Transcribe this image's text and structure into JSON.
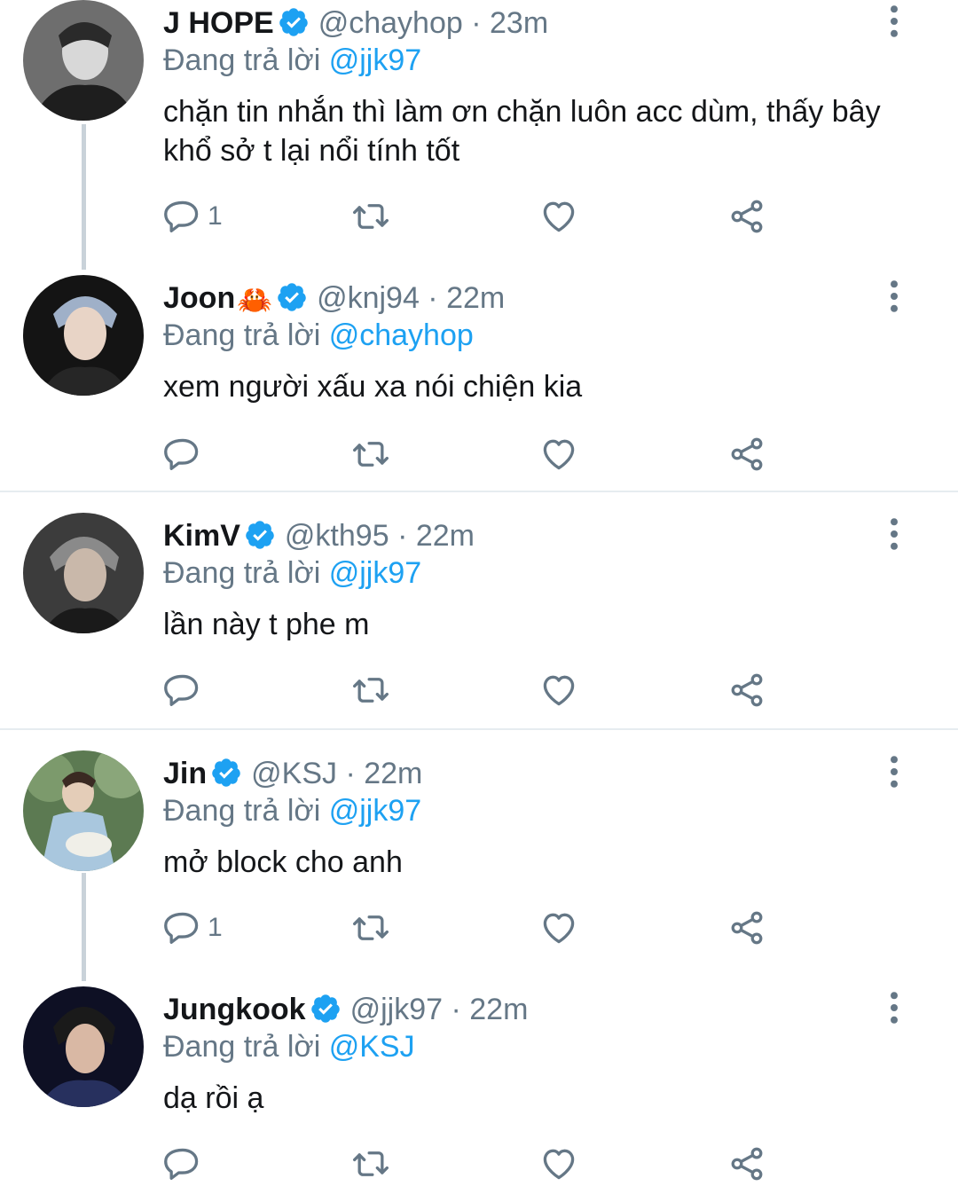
{
  "reply_prefix": "Đang trả lời",
  "tweets": [
    {
      "name": "J HOPE",
      "handle": "@chayhop",
      "time": "23m",
      "reply_to": "@jjk97",
      "text": "chặn tin nhắn thì làm ơn chặn luôn acc dùm, thấy bây khổ sở t lại nổi tính tốt",
      "reply_count": "1"
    },
    {
      "name": "Joon",
      "name_emoji": "🦀",
      "handle": "@knj94",
      "time": "22m",
      "reply_to": "@chayhop",
      "text": "xem người xấu xa nói chiện kia",
      "reply_count": ""
    },
    {
      "name": "KimV",
      "handle": "@kth95",
      "time": "22m",
      "reply_to": "@jjk97",
      "text": "lần này t phe m",
      "reply_count": ""
    },
    {
      "name": "Jin",
      "handle": "@KSJ",
      "time": "22m",
      "reply_to": "@jjk97",
      "text": "mở block cho anh",
      "reply_count": "1"
    },
    {
      "name": "Jungkook",
      "handle": "@jjk97",
      "time": "22m",
      "reply_to": "@KSJ",
      "text": "dạ rồi ạ",
      "reply_count": ""
    }
  ],
  "icons": {
    "reply": "reply-icon",
    "retweet": "retweet-icon",
    "like": "heart-icon",
    "share": "share-icon",
    "more": "more-vertical-icon",
    "verified": "verified-badge-icon"
  },
  "colors": {
    "link": "#1da1f2",
    "muted": "#657786",
    "text": "#141619",
    "thread_line": "#c9d2d9",
    "divider": "#e6ecf0"
  }
}
